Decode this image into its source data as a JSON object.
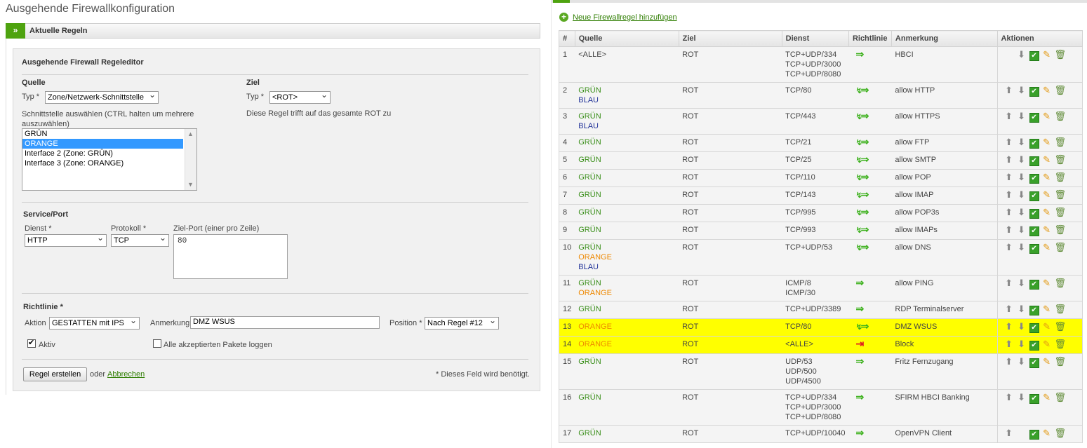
{
  "left": {
    "page_title": "Ausgehende Firewallkonfiguration",
    "section_label": "Aktuelle Regeln",
    "section_toggle": "»",
    "editor_title": "Ausgehende Firewall Regeleditor",
    "source": {
      "title": "Quelle",
      "type_label": "Typ",
      "type_value": "Zone/Netzwerk-Schnittstelle",
      "iface_hint": "Schnittstelle auswählen (CTRL halten um mehrere auszuwählen)",
      "options": [
        "GRÜN",
        "ORANGE",
        "Interface 2 (Zone: GRÜN)",
        "Interface 3 (Zone: ORANGE)"
      ],
      "selected_index": 1
    },
    "target": {
      "title": "Ziel",
      "type_label": "Typ",
      "type_value": "<ROT>",
      "note": "Diese Regel trifft auf das gesamte ROT zu"
    },
    "service": {
      "title": "Service/Port",
      "dienst_label": "Dienst",
      "dienst_value": "HTTP",
      "protokoll_label": "Protokoll",
      "protokoll_value": "TCP",
      "port_label": "Ziel-Port (einer pro Zeile)",
      "port_value": "80"
    },
    "policy": {
      "title": "Richtlinie",
      "aktion_label": "Aktion",
      "aktion_value": "GESTATTEN mit IPS",
      "anmerkung_label": "Anmerkung",
      "anmerkung_value": "DMZ WSUS",
      "position_label": "Position",
      "position_value": "Nach Regel #12",
      "aktiv_label": "Aktiv",
      "aktiv_checked": true,
      "log_label": "Alle akzeptierten Pakete loggen",
      "log_checked": false
    },
    "create_button": "Regel erstellen",
    "or_text": "oder",
    "cancel_link": "Abbrechen",
    "required_note": "* Dieses Feld wird benötigt.",
    "asterisk": "*"
  },
  "right": {
    "add_link": "Neue Firewallregel hinzufügen",
    "columns": [
      "#",
      "Quelle",
      "Ziel",
      "Dienst",
      "Richtlinie",
      "Anmerkung",
      "Aktionen"
    ],
    "rules": [
      {
        "num": "1",
        "src": [
          [
            "<ALLE>",
            "alle"
          ]
        ],
        "dst": "ROT",
        "svc": [
          "TCP+UDP/334",
          "TCP+UDP/3000",
          "TCP+UDP/8080"
        ],
        "policy": "allow",
        "note": "HBCI",
        "up": false,
        "down": true,
        "hl": false
      },
      {
        "num": "2",
        "src": [
          [
            "GRÜN",
            "gruen"
          ],
          [
            "BLAU",
            "blau"
          ]
        ],
        "dst": "ROT",
        "svc": [
          "TCP/80"
        ],
        "policy": "ips",
        "note": "allow HTTP",
        "up": true,
        "down": true,
        "hl": false
      },
      {
        "num": "3",
        "src": [
          [
            "GRÜN",
            "gruen"
          ],
          [
            "BLAU",
            "blau"
          ]
        ],
        "dst": "ROT",
        "svc": [
          "TCP/443"
        ],
        "policy": "ips",
        "note": "allow HTTPS",
        "up": true,
        "down": true,
        "hl": false
      },
      {
        "num": "4",
        "src": [
          [
            "GRÜN",
            "gruen"
          ]
        ],
        "dst": "ROT",
        "svc": [
          "TCP/21"
        ],
        "policy": "ips",
        "note": "allow FTP",
        "up": true,
        "down": true,
        "hl": false
      },
      {
        "num": "5",
        "src": [
          [
            "GRÜN",
            "gruen"
          ]
        ],
        "dst": "ROT",
        "svc": [
          "TCP/25"
        ],
        "policy": "ips",
        "note": "allow SMTP",
        "up": true,
        "down": true,
        "hl": false
      },
      {
        "num": "6",
        "src": [
          [
            "GRÜN",
            "gruen"
          ]
        ],
        "dst": "ROT",
        "svc": [
          "TCP/110"
        ],
        "policy": "ips",
        "note": "allow POP",
        "up": true,
        "down": true,
        "hl": false
      },
      {
        "num": "7",
        "src": [
          [
            "GRÜN",
            "gruen"
          ]
        ],
        "dst": "ROT",
        "svc": [
          "TCP/143"
        ],
        "policy": "ips",
        "note": "allow IMAP",
        "up": true,
        "down": true,
        "hl": false
      },
      {
        "num": "8",
        "src": [
          [
            "GRÜN",
            "gruen"
          ]
        ],
        "dst": "ROT",
        "svc": [
          "TCP/995"
        ],
        "policy": "ips",
        "note": "allow POP3s",
        "up": true,
        "down": true,
        "hl": false
      },
      {
        "num": "9",
        "src": [
          [
            "GRÜN",
            "gruen"
          ]
        ],
        "dst": "ROT",
        "svc": [
          "TCP/993"
        ],
        "policy": "ips",
        "note": "allow IMAPs",
        "up": true,
        "down": true,
        "hl": false
      },
      {
        "num": "10",
        "src": [
          [
            "GRÜN",
            "gruen"
          ],
          [
            "ORANGE",
            "orange"
          ],
          [
            "BLAU",
            "blau"
          ]
        ],
        "dst": "ROT",
        "svc": [
          "TCP+UDP/53"
        ],
        "policy": "ips",
        "note": "allow DNS",
        "up": true,
        "down": true,
        "hl": false
      },
      {
        "num": "11",
        "src": [
          [
            "GRÜN",
            "gruen"
          ],
          [
            "ORANGE",
            "orange"
          ]
        ],
        "dst": "ROT",
        "svc": [
          "ICMP/8",
          "ICMP/30"
        ],
        "policy": "allow",
        "note": "allow PING",
        "up": true,
        "down": true,
        "hl": false
      },
      {
        "num": "12",
        "src": [
          [
            "GRÜN",
            "gruen"
          ]
        ],
        "dst": "ROT",
        "svc": [
          "TCP+UDP/3389"
        ],
        "policy": "allow",
        "note": "RDP Terminalserver",
        "up": true,
        "down": true,
        "hl": false
      },
      {
        "num": "13",
        "src": [
          [
            "ORANGE",
            "orange"
          ]
        ],
        "dst": "ROT",
        "svc": [
          "TCP/80"
        ],
        "policy": "ips",
        "note": "DMZ WSUS",
        "up": true,
        "down": true,
        "hl": true
      },
      {
        "num": "14",
        "src": [
          [
            "ORANGE",
            "orange"
          ]
        ],
        "dst": "ROT",
        "svc": [
          "<ALLE>"
        ],
        "policy": "block",
        "note": "Block",
        "up": true,
        "down": true,
        "hl": true
      },
      {
        "num": "15",
        "src": [
          [
            "GRÜN",
            "gruen"
          ]
        ],
        "dst": "ROT",
        "svc": [
          "UDP/53",
          "UDP/500",
          "UDP/4500"
        ],
        "policy": "allow",
        "note": "Fritz Fernzugang",
        "up": true,
        "down": true,
        "hl": false
      },
      {
        "num": "16",
        "src": [
          [
            "GRÜN",
            "gruen"
          ]
        ],
        "dst": "ROT",
        "svc": [
          "TCP+UDP/334",
          "TCP+UDP/3000",
          "TCP+UDP/8080"
        ],
        "policy": "allow",
        "note": "SFIRM HBCI Banking",
        "up": true,
        "down": true,
        "hl": false
      },
      {
        "num": "17",
        "src": [
          [
            "GRÜN",
            "gruen"
          ]
        ],
        "dst": "ROT",
        "svc": [
          "TCP+UDP/10040"
        ],
        "policy": "allow",
        "note": "OpenVPN Client",
        "up": true,
        "down": false,
        "hl": false
      }
    ]
  },
  "colors": {
    "accent_green": "#4ea30f",
    "zone_green": "#3a8f1a",
    "zone_blue": "#223399",
    "zone_orange": "#ee8800",
    "zone_red": "#b00000",
    "highlight": "#ffff00"
  },
  "icons": [
    "add-icon",
    "allow-arrow-icon",
    "ips-arrow-icon",
    "block-arrow-icon",
    "move-up-icon",
    "move-down-icon",
    "enable-toggle-icon",
    "edit-icon",
    "delete-icon"
  ]
}
